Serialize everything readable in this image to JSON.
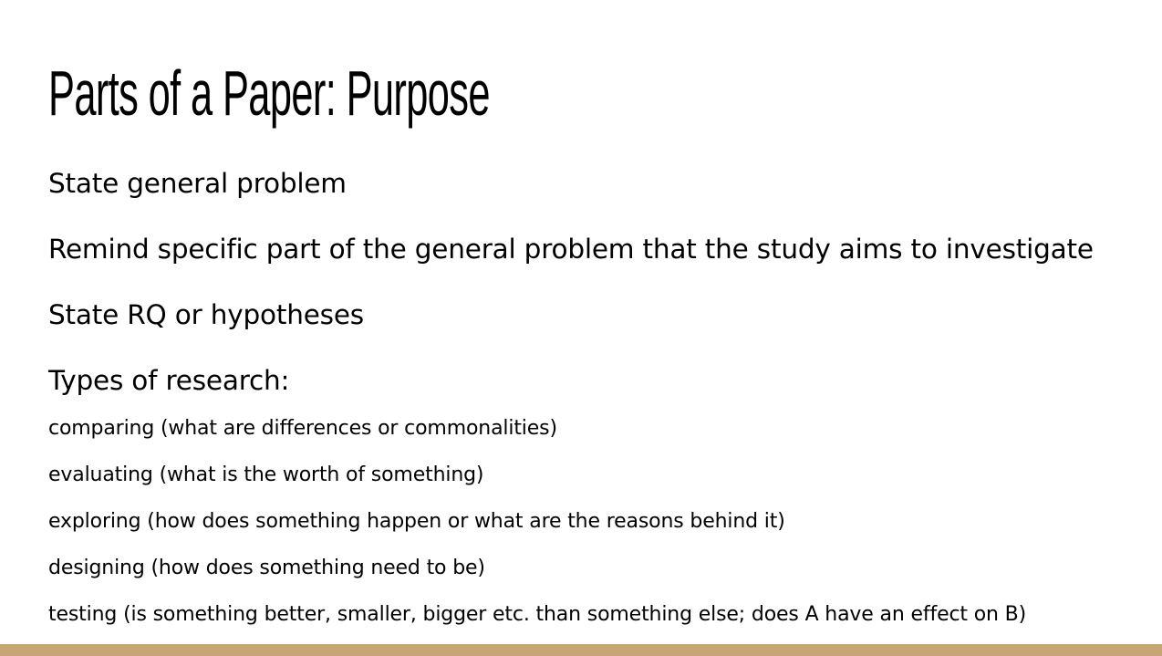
{
  "slide": {
    "title": "Parts of a Paper: Purpose",
    "points": [
      "State general problem",
      "Remind specific part of the general problem that the study aims to investigate",
      "State RQ or hypotheses",
      "Types of research:"
    ],
    "research_types": [
      "comparing (what are differences or commonalities)",
      "evaluating (what is the worth of something)",
      "exploring (how does something happen or what are the reasons behind it)",
      "designing (how does something need to be)",
      "testing (is something better, smaller, bigger etc. than something else; does A have an effect on B)"
    ]
  },
  "colors": {
    "accent_bar": "#c7a574",
    "background": "#ffffff",
    "text": "#000000"
  }
}
